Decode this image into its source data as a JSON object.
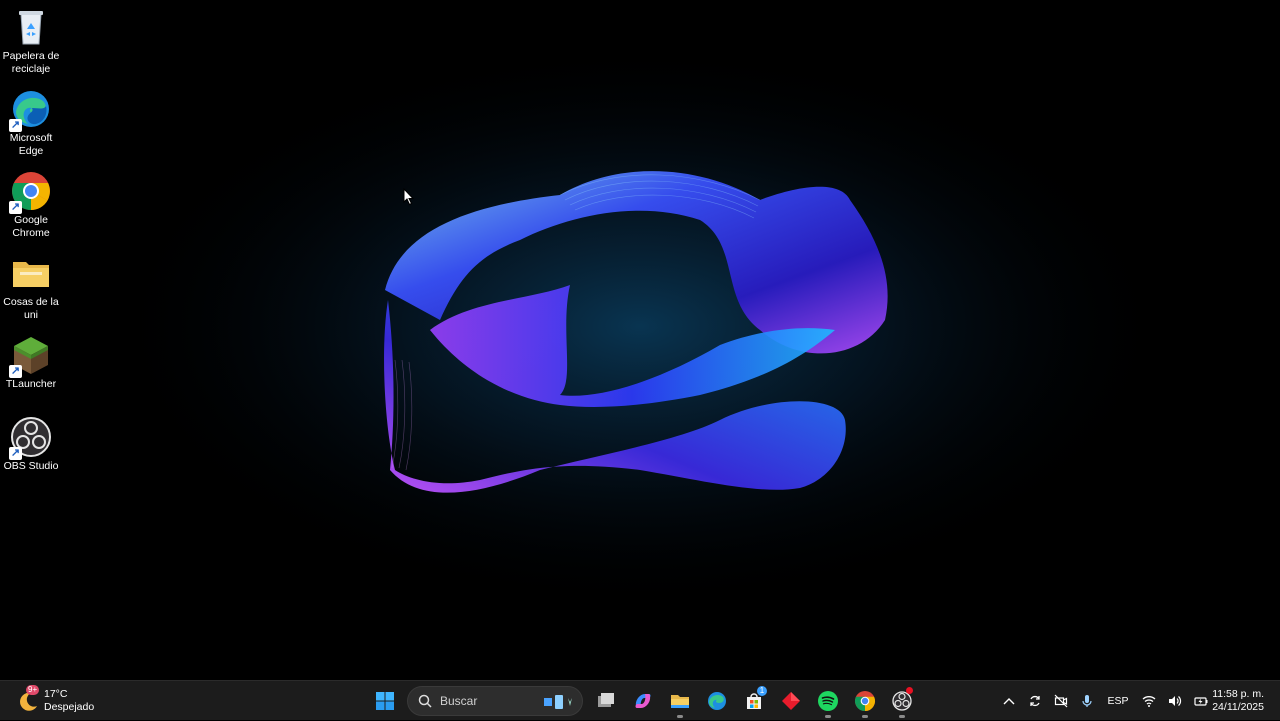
{
  "desktop": {
    "icons": [
      {
        "label": "Papelera de reciclaje",
        "icon": "recycle-bin-icon"
      },
      {
        "label": "Microsoft Edge",
        "icon": "edge-icon"
      },
      {
        "label": "Google Chrome",
        "icon": "chrome-icon"
      },
      {
        "label": "Cosas de la uni",
        "icon": "folder-icon"
      },
      {
        "label": "TLauncher",
        "icon": "tlauncher-icon"
      },
      {
        "label": "OBS Studio",
        "icon": "obs-icon"
      }
    ]
  },
  "taskbar": {
    "weather": {
      "temp": "17°C",
      "condition": "Despejado",
      "badge": "9+"
    },
    "search": {
      "placeholder": "Buscar"
    },
    "apps": [
      {
        "name": "start-icon"
      },
      {
        "name": "task-view-icon"
      },
      {
        "name": "copilot-icon"
      },
      {
        "name": "file-explorer-icon"
      },
      {
        "name": "edge-icon"
      },
      {
        "name": "store-icon",
        "badge": "1"
      },
      {
        "name": "red-diamond-app-icon"
      },
      {
        "name": "spotify-icon"
      },
      {
        "name": "chrome-icon"
      },
      {
        "name": "obs-icon"
      }
    ],
    "tray": {
      "language": "ESP"
    },
    "clock": {
      "time": "11:58 p. m.",
      "date": "24/11/2025"
    }
  },
  "colors": {
    "taskbar_bg": "#1c1c1c",
    "accent": "#3aa0ff",
    "wallpaper_bg": "#000000"
  }
}
